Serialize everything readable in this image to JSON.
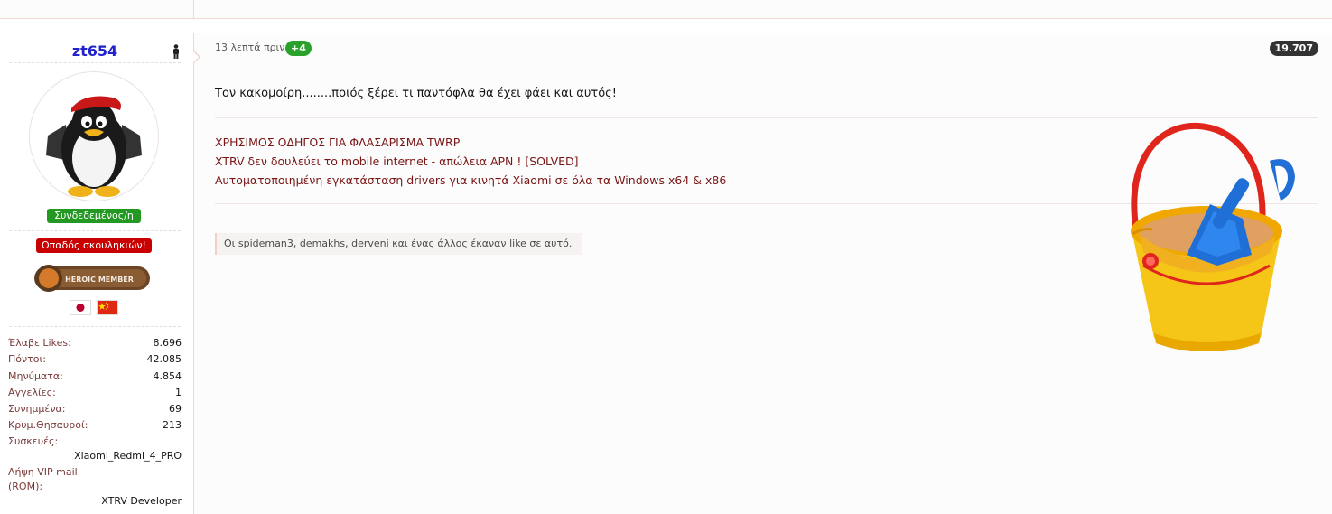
{
  "user": {
    "username": "zt654",
    "status_badge": "Συνδεδεμένος/η",
    "group_badge": "Οπαδός σκουληκιών!",
    "heroic_badge": "HEROIC MEMBER",
    "stats": [
      {
        "label": "Έλαβε Likes:",
        "value": "8.696"
      },
      {
        "label": "Πόντοι:",
        "value": "42.085"
      },
      {
        "label": "Μηνύματα:",
        "value": "4.854"
      },
      {
        "label": "Αγγελίες:",
        "value": "1"
      },
      {
        "label": "Συνημμένα:",
        "value": "69"
      },
      {
        "label": "Κρυμ.Θησαυροί:",
        "value": "213"
      }
    ],
    "devices_label": "Συσκευές:",
    "devices_value": "Xiaomi_Redmi_4_PRO",
    "vip_label": "Λήψη VIP mail (ROM):",
    "vip_value": "XTRV Developer"
  },
  "post": {
    "time": "13 λεπτά πριν",
    "plus": "+4",
    "number": "19.707",
    "message": "Τον κακομοίρη........ποιός ξέρει τι παντόφλα θα έχει φάει και αυτός!",
    "signature_links": [
      "ΧΡΗΣΙΜΟΣ ΟΔΗΓΟΣ ΓΙΑ ΦΛΑΣΑΡΙΣΜΑ TWRP",
      "XTRV δεν δουλεύει το mobile internet - απώλεια APN ! [SOLVED]",
      "Αυτοματοποιημένη εγκατάσταση drivers για κινητά Xiaomi σε όλα τα Windows x64 & x86"
    ],
    "likes_text": "Οι spideman3, demakhs, derveni και ένας άλλος έκαναν like σε αυτό."
  },
  "colors": {
    "username": "#2222cc",
    "online": "#239923",
    "group": "#c80000",
    "link": "#7a1515"
  }
}
